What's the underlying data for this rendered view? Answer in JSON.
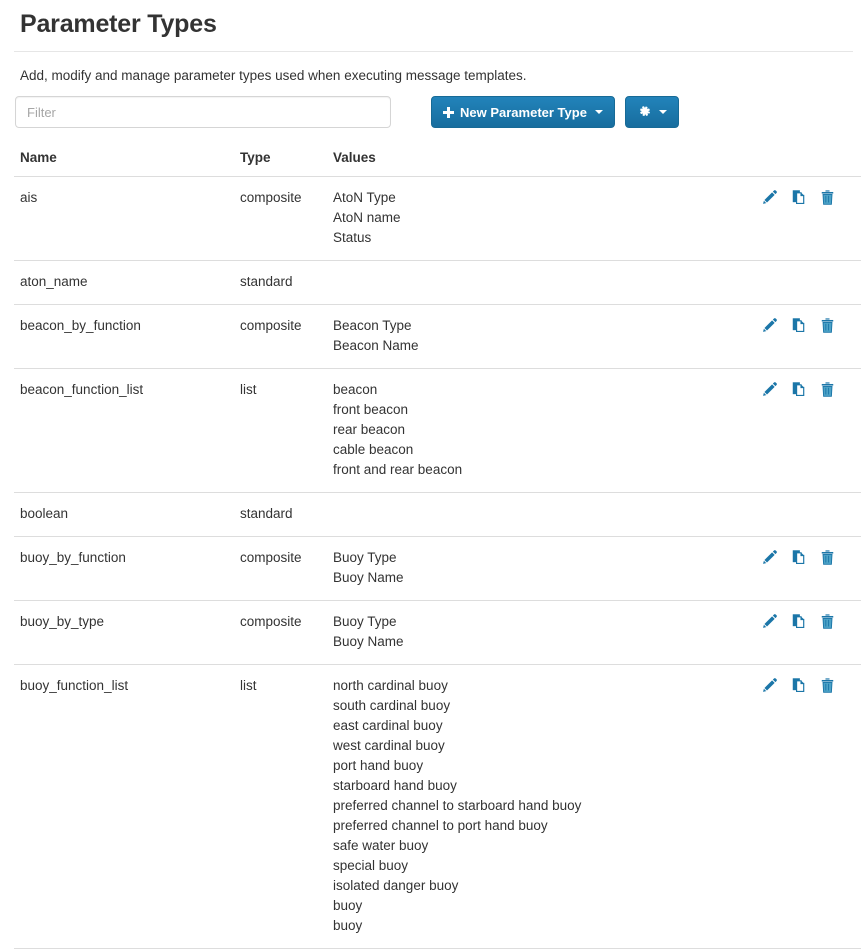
{
  "header": {
    "title": "Parameter Types",
    "description": "Add, modify and manage parameter types used when executing message templates."
  },
  "toolbar": {
    "filter_placeholder": "Filter",
    "filter_value": "",
    "new_button_label": "New Parameter Type",
    "new_button_icon": "plus-icon",
    "settings_button_icon": "gear-icon",
    "accent_color": "#1b76a8"
  },
  "table": {
    "columns": [
      "Name",
      "Type",
      "Values"
    ],
    "row_actions": [
      "edit-icon",
      "copy-icon",
      "delete-icon"
    ],
    "rows": [
      {
        "name": "ais",
        "type": "composite",
        "values": [
          "AtoN Type",
          "AtoN name",
          "Status"
        ],
        "has_actions": true
      },
      {
        "name": "aton_name",
        "type": "standard",
        "values": [],
        "has_actions": false
      },
      {
        "name": "beacon_by_function",
        "type": "composite",
        "values": [
          "Beacon Type",
          "Beacon Name"
        ],
        "has_actions": true
      },
      {
        "name": "beacon_function_list",
        "type": "list",
        "values": [
          "beacon",
          "front beacon",
          "rear beacon",
          "cable beacon",
          "front and rear beacon"
        ],
        "has_actions": true
      },
      {
        "name": "boolean",
        "type": "standard",
        "values": [],
        "has_actions": false
      },
      {
        "name": "buoy_by_function",
        "type": "composite",
        "values": [
          "Buoy Type",
          "Buoy Name"
        ],
        "has_actions": true
      },
      {
        "name": "buoy_by_type",
        "type": "composite",
        "values": [
          "Buoy Type",
          "Buoy Name"
        ],
        "has_actions": true
      },
      {
        "name": "buoy_function_list",
        "type": "list",
        "values": [
          "north cardinal buoy",
          "south cardinal buoy",
          "east cardinal buoy",
          "west cardinal buoy",
          "port hand buoy",
          "starboard hand buoy",
          "preferred channel to starboard hand buoy",
          "preferred channel to port hand buoy",
          "safe water buoy",
          "special buoy",
          "isolated danger buoy",
          "buoy",
          "buoy"
        ],
        "has_actions": true
      }
    ]
  }
}
